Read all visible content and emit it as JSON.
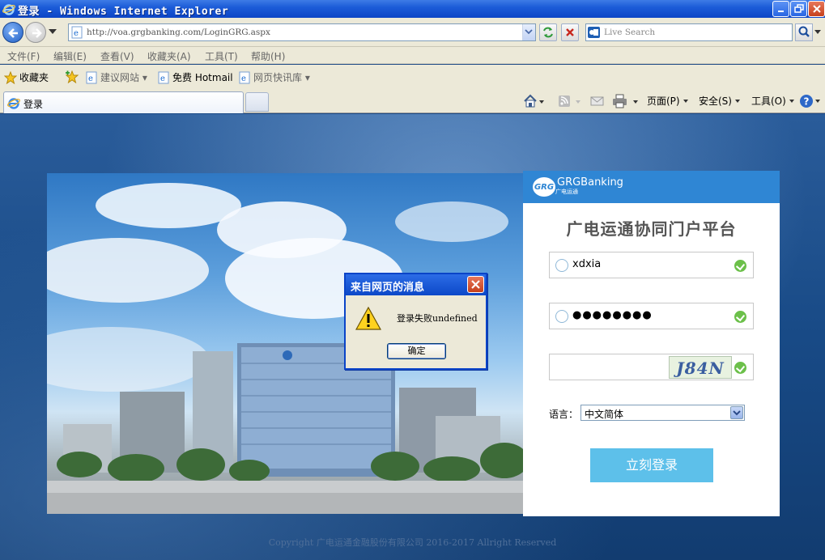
{
  "window": {
    "title": "登录 - Windows Internet Explorer"
  },
  "address_bar": {
    "url": "http://voa.grgbanking.com/LoginGRG.aspx",
    "search_placeholder": "Live Search"
  },
  "menu": {
    "items": [
      "文件(F)",
      "编辑(E)",
      "查看(V)",
      "收藏夹(A)",
      "工具(T)",
      "帮助(H)"
    ]
  },
  "favorites_bar": {
    "favorites_label": "收藏夹",
    "links": [
      "建议网站 ▾",
      "免费 Hotmail",
      "网页快讯库 ▾"
    ]
  },
  "tabs": {
    "active_tab_label": "登录"
  },
  "command_bar": {
    "page_label": "页面(P)",
    "safety_label": "安全(S)",
    "tools_label": "工具(O)"
  },
  "login": {
    "brand": "GRGBanking",
    "brand_sub": "广电运通",
    "title": "广电运通协同门户平台",
    "username": "xdxia",
    "password_mask": "●●●●●●●●",
    "captcha_text": "J84N",
    "language_label": "语言：",
    "language_value": "中文简体",
    "login_button": "立刻登录"
  },
  "footer": {
    "copyright": "Copyright 广电运通金融股份有限公司 2016-2017 Allright Reserved"
  },
  "dialog": {
    "title": "来自网页的消息",
    "message": "登录失败undefined",
    "ok_button": "确定"
  }
}
